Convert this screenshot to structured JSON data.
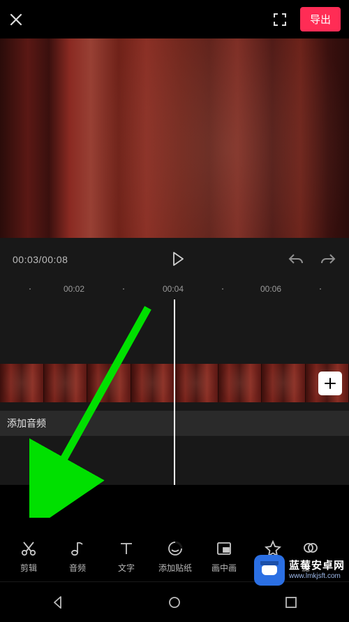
{
  "header": {
    "export_label": "导出"
  },
  "playback": {
    "current": "00:03",
    "total": "00:08"
  },
  "ruler": {
    "t1": "00:02",
    "t2": "00:04",
    "t3": "00:06"
  },
  "tracks": {
    "add_audio_label": "添加音频"
  },
  "tools": [
    {
      "id": "edit",
      "label": "剪辑"
    },
    {
      "id": "audio",
      "label": "音频"
    },
    {
      "id": "text",
      "label": "文字"
    },
    {
      "id": "sticker",
      "label": "添加贴纸"
    },
    {
      "id": "pip",
      "label": "画中画"
    },
    {
      "id": "effects",
      "label": "特效"
    },
    {
      "id": "filter",
      "label": "滤"
    }
  ],
  "watermark": {
    "title": "蓝莓安卓网",
    "url": "www.lmkjsft.com"
  }
}
